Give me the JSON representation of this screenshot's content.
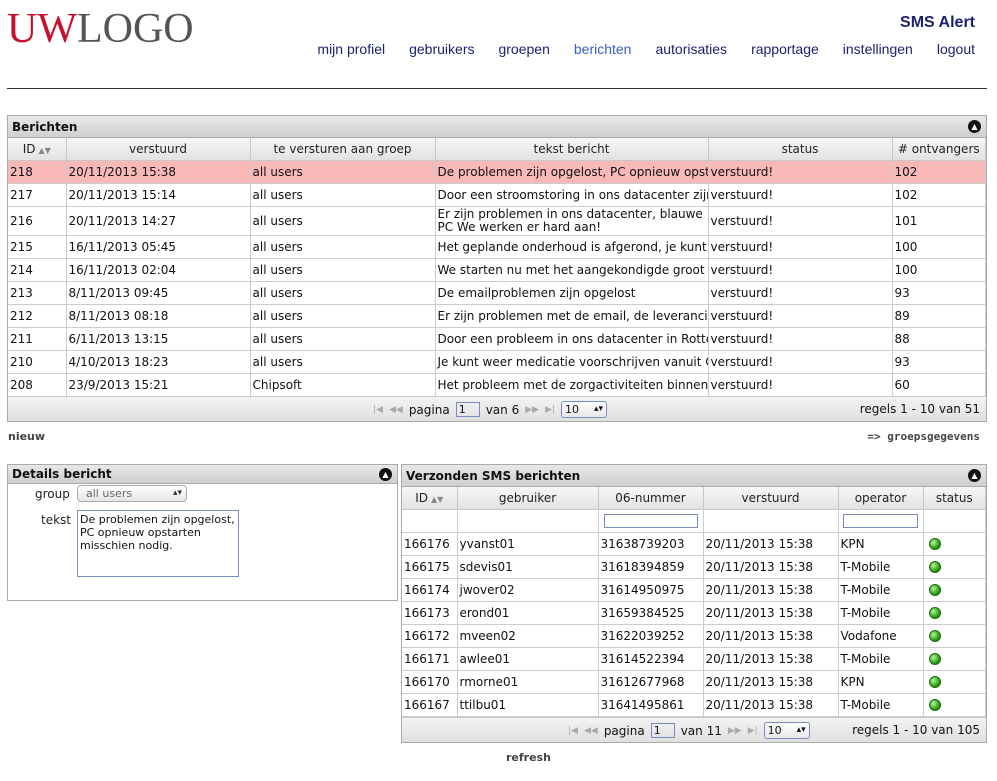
{
  "header": {
    "logo_part1": "UW",
    "logo_part2": "LOGO",
    "app_title": "SMS Alert",
    "nav": [
      "mijn profiel",
      "gebruikers",
      "groepen",
      "berichten",
      "autorisaties",
      "rapportage",
      "instellingen",
      "logout"
    ],
    "active_nav": "berichten"
  },
  "messages": {
    "title": "Berichten",
    "columns": [
      "ID",
      "verstuurd",
      "te versturen aan groep",
      "tekst bericht",
      "status",
      "# ontvangers"
    ],
    "rows": [
      {
        "id": "218",
        "sent": "20/11/2013 15:38",
        "group": "all users",
        "text": "De problemen zijn opgelost, PC opnieuw opstar",
        "status": "verstuurd!",
        "count": "102"
      },
      {
        "id": "217",
        "sent": "20/11/2013 15:14",
        "group": "all users",
        "text": "Door een stroomstoring in ons datacenter zijn b",
        "status": "verstuurd!",
        "count": "102"
      },
      {
        "id": "216",
        "sent": "20/11/2013 14:27",
        "group": "all users",
        "text": "Er zijn problemen in ons datacenter, blauwe PC We werken er hard aan!",
        "status": "verstuurd!",
        "count": "101"
      },
      {
        "id": "215",
        "sent": "16/11/2013 05:45",
        "group": "all users",
        "text": "Het geplande onderhoud is afgerond, je kunt w",
        "status": "verstuurd!",
        "count": "100"
      },
      {
        "id": "214",
        "sent": "16/11/2013 02:04",
        "group": "all users",
        "text": "We starten nu met het aangekondigde groot IC",
        "status": "verstuurd!",
        "count": "100"
      },
      {
        "id": "213",
        "sent": "8/11/2013 09:45",
        "group": "all users",
        "text": "De emailproblemen zijn opgelost",
        "status": "verstuurd!",
        "count": "93"
      },
      {
        "id": "212",
        "sent": "8/11/2013 08:18",
        "group": "all users",
        "text": "Er zijn problemen met de email, de leverancier",
        "status": "verstuurd!",
        "count": "89"
      },
      {
        "id": "211",
        "sent": "6/11/2013 13:15",
        "group": "all users",
        "text": "Door een probleem in ons datacenter in Rotterd",
        "status": "verstuurd!",
        "count": "88"
      },
      {
        "id": "210",
        "sent": "4/10/2013 18:23",
        "group": "all users",
        "text": "Je kunt weer medicatie voorschrijven vanuit Ch",
        "status": "verstuurd!",
        "count": "93"
      },
      {
        "id": "208",
        "sent": "23/9/2013 15:21",
        "group": "Chipsoft",
        "text": "Het probleem met de zorgactiviteiten binnen Ch",
        "status": "verstuurd!",
        "count": "60"
      }
    ],
    "pager": {
      "page_label": "pagina",
      "page": "1",
      "of": "van 6",
      "per_page": "10",
      "summary": "regels 1 - 10 van 51"
    },
    "new_link": "nieuw",
    "group_link": "=> groepsgegevens"
  },
  "details": {
    "title": "Details bericht",
    "group_label": "group",
    "group_value": "all users",
    "text_label": "tekst",
    "text_value": "De problemen zijn opgelost,\nPC opnieuw opstarten\nmisschien nodig."
  },
  "sms": {
    "title": "Verzonden SMS berichten",
    "columns": [
      "ID",
      "gebruiker",
      "06-nummer",
      "verstuurd",
      "operator",
      "status"
    ],
    "rows": [
      {
        "id": "166176",
        "user": "yvanst01",
        "number": "31638739203",
        "sent": "20/11/2013 15:38",
        "operator": "KPN"
      },
      {
        "id": "166175",
        "user": "sdevis01",
        "number": "31618394859",
        "sent": "20/11/2013 15:38",
        "operator": "T-Mobile"
      },
      {
        "id": "166174",
        "user": "jwover02",
        "number": "31614950975",
        "sent": "20/11/2013 15:38",
        "operator": "T-Mobile"
      },
      {
        "id": "166173",
        "user": "erond01",
        "number": "31659384525",
        "sent": "20/11/2013 15:38",
        "operator": "T-Mobile"
      },
      {
        "id": "166172",
        "user": "mveen02",
        "number": "31622039252",
        "sent": "20/11/2013 15:38",
        "operator": "Vodafone"
      },
      {
        "id": "166171",
        "user": "awlee01",
        "number": "31614522394",
        "sent": "20/11/2013 15:38",
        "operator": "T-Mobile"
      },
      {
        "id": "166170",
        "user": "rmorne01",
        "number": "31612677968",
        "sent": "20/11/2013 15:38",
        "operator": "KPN"
      },
      {
        "id": "166167",
        "user": "ttilbu01",
        "number": "31641495861",
        "sent": "20/11/2013 15:38",
        "operator": "T-Mobile"
      }
    ],
    "pager": {
      "page_label": "pagina",
      "page": "1",
      "of": "van 11",
      "per_page": "10",
      "summary": "regels 1 - 10 van 105"
    },
    "refresh_link": "refresh"
  }
}
